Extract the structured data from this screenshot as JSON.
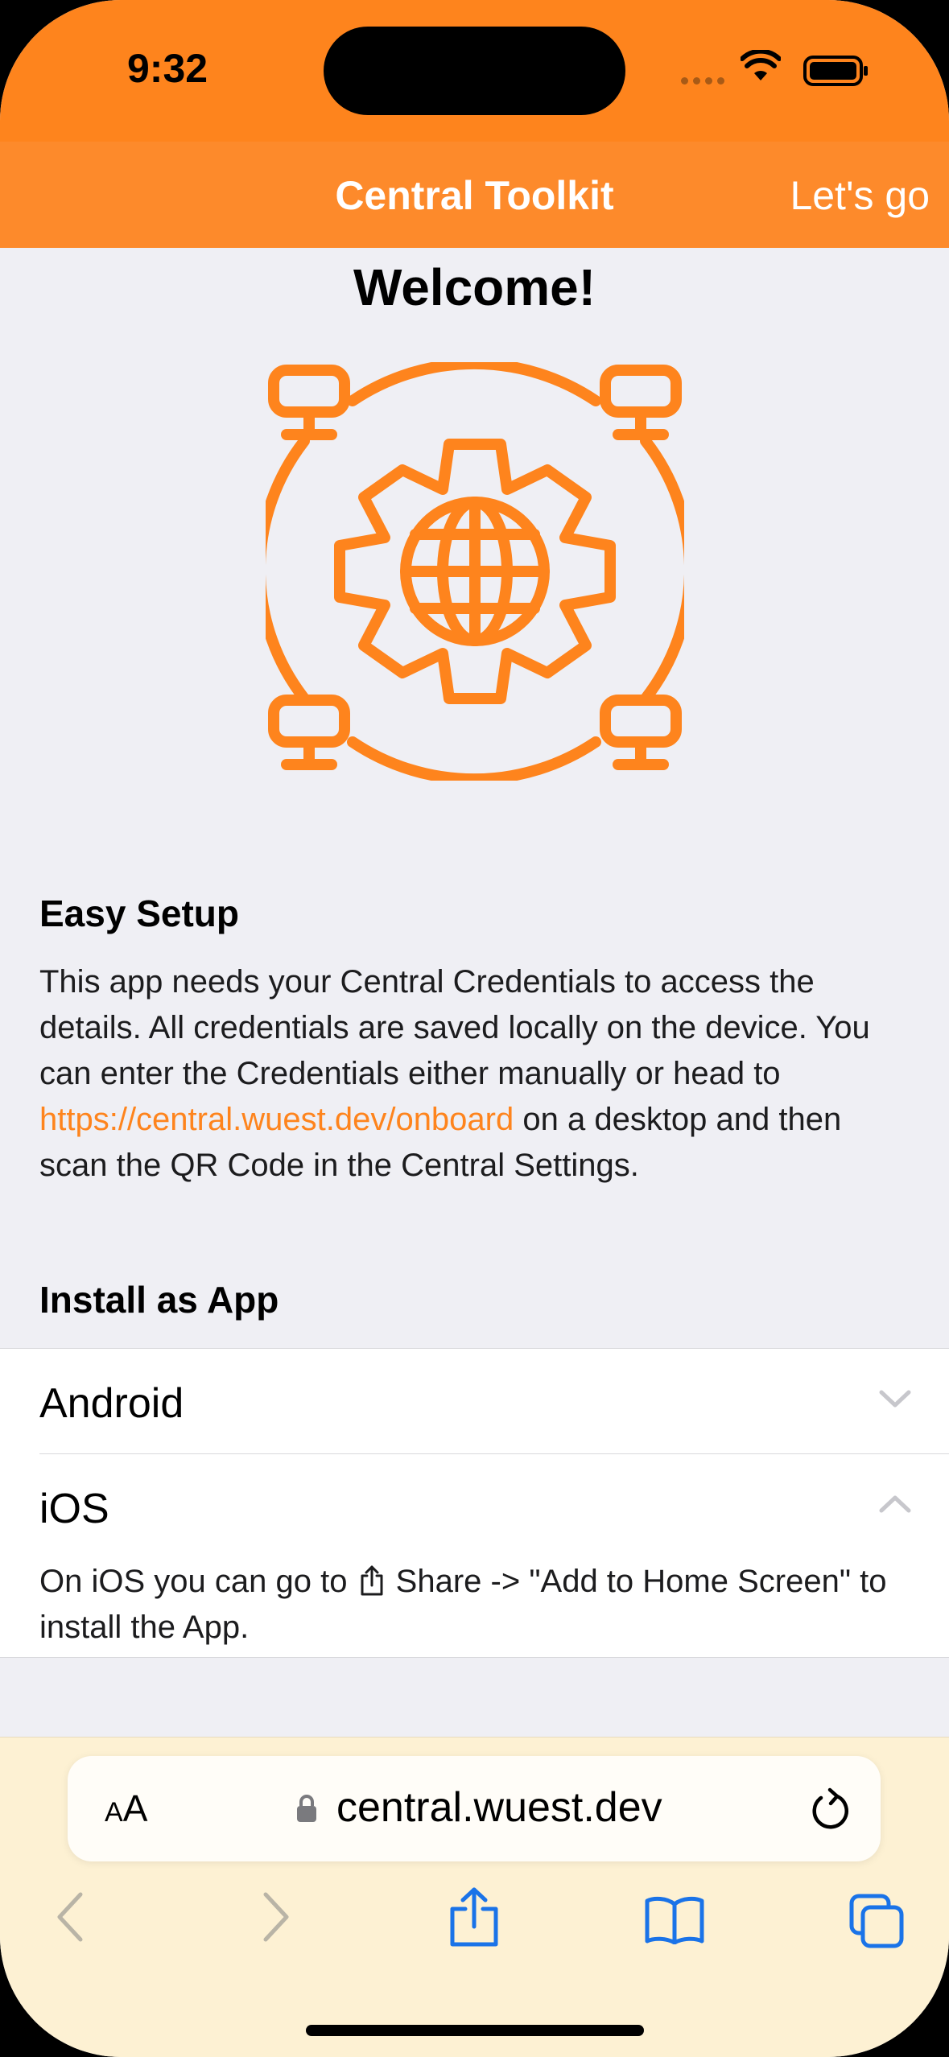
{
  "status": {
    "time": "9:32"
  },
  "nav": {
    "title": "Central Toolkit",
    "action": "Let's go"
  },
  "page": {
    "welcome": "Welcome!",
    "easy_setup": {
      "title": "Easy Setup",
      "text_before": "This app needs your Central Credentials to access the details. All credentials are saved locally on the device. You can enter the Credentials either manually or head to ",
      "link": "https://central.wuest.dev/onboard",
      "text_after": " on a desktop and then scan the QR Code in the Central Settings."
    },
    "install": {
      "title": "Install as App",
      "android_label": "Android",
      "ios_label": "iOS",
      "ios_text_before": "On iOS you can go to ",
      "ios_text_after": " Share -> \"Add to Home Screen\" to install the App."
    }
  },
  "browser": {
    "aa_small": "A",
    "aa_large": "A",
    "url": "central.wuest.dev"
  },
  "colors": {
    "accent": "#fe841d",
    "link": "#fe841d",
    "toolbar_blue": "#1a73e8",
    "toolbar_bg": "#fdf1d3"
  },
  "icons": [
    "wifi-icon",
    "battery-icon",
    "network-gear-globe-icon",
    "chevron-down-icon",
    "chevron-up-icon",
    "share-icon",
    "lock-icon",
    "reload-icon",
    "back-icon",
    "forward-icon",
    "bookmarks-icon",
    "tabs-icon"
  ]
}
